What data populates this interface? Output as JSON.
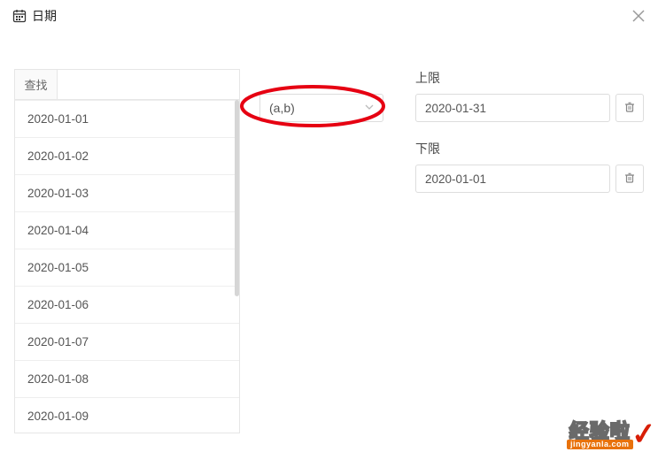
{
  "header": {
    "title": "日期"
  },
  "list": {
    "search_label": "查找",
    "search_value": "",
    "items": [
      "2020-01-01",
      "2020-01-02",
      "2020-01-03",
      "2020-01-04",
      "2020-01-05",
      "2020-01-06",
      "2020-01-07",
      "2020-01-08",
      "2020-01-09"
    ]
  },
  "range": {
    "selected": "(a,b)"
  },
  "upper": {
    "label": "上限",
    "value": "2020-01-31"
  },
  "lower": {
    "label": "下限",
    "value": "2020-01-01"
  },
  "watermark": {
    "main": "经验啦",
    "sub": "jingyanla.com",
    "check": "✓"
  }
}
